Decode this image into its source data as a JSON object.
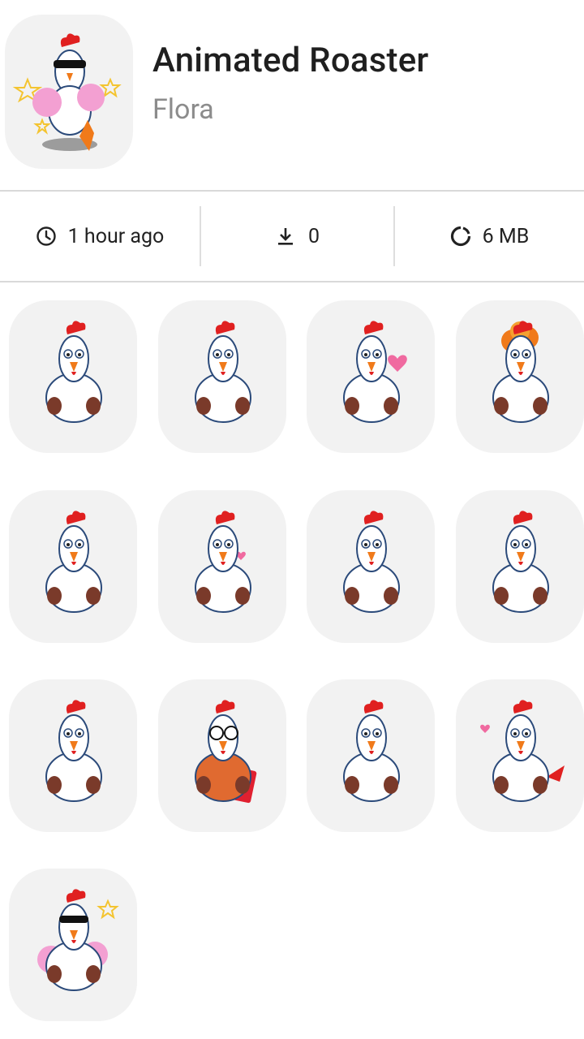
{
  "pack": {
    "title": "Animated Roaster",
    "author": "Flora"
  },
  "stats": {
    "time": {
      "icon": "clock-icon",
      "label": "1 hour ago"
    },
    "downloads": {
      "icon": "download-icon",
      "label": "0"
    },
    "size": {
      "icon": "size-ring-icon",
      "label": "6 MB"
    }
  },
  "stickers": [
    {
      "name": "sticker-rooster-thumbs-up",
      "pose": "thumbs"
    },
    {
      "name": "sticker-rooster-thumbs-up-2",
      "pose": "thumbs"
    },
    {
      "name": "sticker-rooster-heartbroken",
      "pose": "heart"
    },
    {
      "name": "sticker-rooster-mind-blown",
      "pose": "mindblown"
    },
    {
      "name": "sticker-rooster-laughing",
      "pose": "laugh"
    },
    {
      "name": "sticker-rooster-kiss",
      "pose": "kiss"
    },
    {
      "name": "sticker-rooster-dancing",
      "pose": "dance"
    },
    {
      "name": "sticker-rooster-money",
      "pose": "money"
    },
    {
      "name": "sticker-rooster-muscles",
      "pose": "muscle"
    },
    {
      "name": "sticker-rooster-clipboard",
      "pose": "clipboard"
    },
    {
      "name": "sticker-rooster-ok-sign",
      "pose": "ok"
    },
    {
      "name": "sticker-rooster-shy",
      "pose": "shy"
    },
    {
      "name": "sticker-rooster-cheerleader",
      "pose": "cheer"
    }
  ],
  "colors": {
    "tile_background": "#f2f2f2",
    "divider": "#d9d9d9",
    "rooster_body": "#ffffff",
    "rooster_comb": "#e02020",
    "rooster_beak": "#f07a1a",
    "rooster_outline": "#2b4a7a"
  }
}
